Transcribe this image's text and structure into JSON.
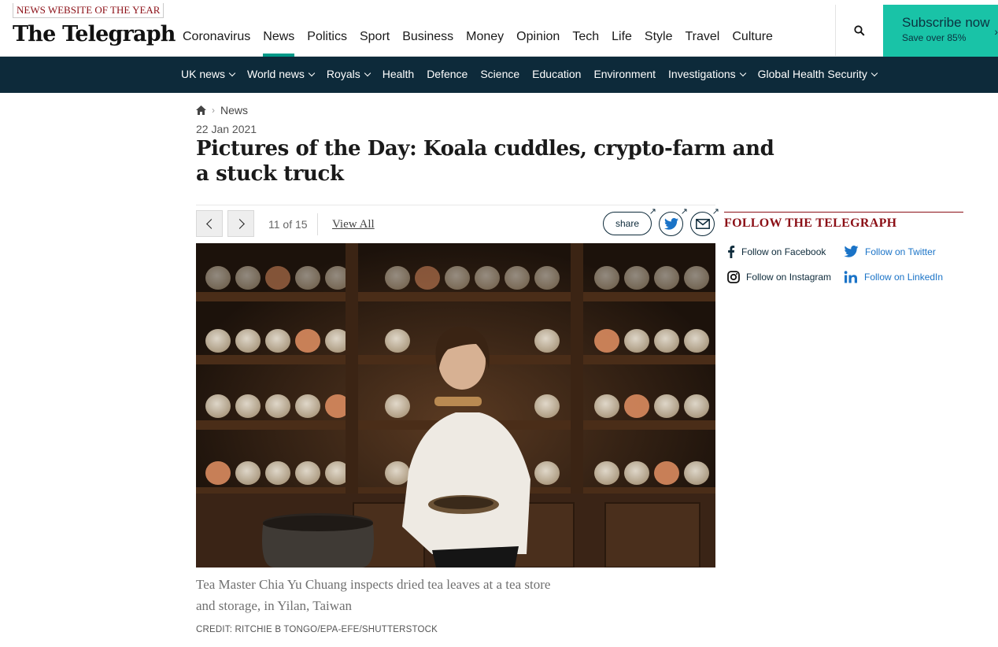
{
  "header": {
    "award": "NEWS WEBSITE OF THE YEAR",
    "logo": "The Telegraph",
    "nav": [
      "Coronavirus",
      "News",
      "Politics",
      "Sport",
      "Business",
      "Money",
      "Opinion",
      "Tech",
      "Life",
      "Style",
      "Travel",
      "Culture"
    ],
    "active_nav": "News",
    "subscribe": {
      "title": "Subscribe now",
      "subtitle": "Save over 85%"
    }
  },
  "subnav": [
    {
      "label": "UK news",
      "dropdown": true
    },
    {
      "label": "World news",
      "dropdown": true
    },
    {
      "label": "Royals",
      "dropdown": true
    },
    {
      "label": "Health",
      "dropdown": false
    },
    {
      "label": "Defence",
      "dropdown": false
    },
    {
      "label": "Science",
      "dropdown": false
    },
    {
      "label": "Education",
      "dropdown": false
    },
    {
      "label": "Environment",
      "dropdown": false
    },
    {
      "label": "Investigations",
      "dropdown": true
    },
    {
      "label": "Global Health Security",
      "dropdown": true
    }
  ],
  "article": {
    "breadcrumb": "News",
    "date": "22 Jan 2021",
    "headline": "Pictures of the Day: Koala cuddles, crypto-farm and a stuck truck"
  },
  "gallery": {
    "counter": "11 of 15",
    "view_all": "View All",
    "share": "share",
    "caption": "Tea Master Chia Yu Chuang inspects dried tea leaves at a tea store and storage, in Yilan, Taiwan",
    "credit": "CREDIT: RITCHIE B TONGO/EPA-EFE/SHUTTERSTOCK"
  },
  "sidebar": {
    "title": "FOLLOW THE TELEGRAPH",
    "links": {
      "facebook": "Follow on Facebook",
      "twitter": "Follow on Twitter",
      "instagram": "Follow on Instagram",
      "linkedin": "Follow on LinkedIn"
    }
  },
  "colors": {
    "navy": "#0d2a3a",
    "teal": "#19c3a7",
    "accent_red": "#8b0f16",
    "link_blue": "#1a73c7"
  }
}
